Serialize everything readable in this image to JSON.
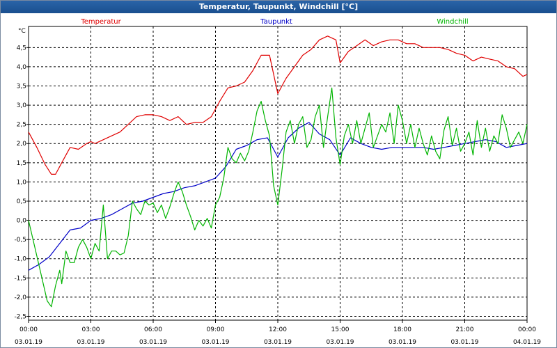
{
  "window": {
    "title": "Temperatur, Taupunkt, Windchill [°C]"
  },
  "chart_data": {
    "type": "line",
    "title": "Temperatur, Taupunkt, Windchill [°C]",
    "ylabel": "°C",
    "ylim": [
      -2.6,
      5.05
    ],
    "xlim": [
      0,
      24
    ],
    "grid": true,
    "legend_placement": "top",
    "y_ticks": [
      {
        "v": 4.5,
        "label": "4,5"
      },
      {
        "v": 4.0,
        "label": "4,0"
      },
      {
        "v": 3.5,
        "label": "3,5"
      },
      {
        "v": 3.0,
        "label": "3,0"
      },
      {
        "v": 2.5,
        "label": "2,5"
      },
      {
        "v": 2.0,
        "label": "2,0"
      },
      {
        "v": 1.5,
        "label": "1,5"
      },
      {
        "v": 1.0,
        "label": "1,0"
      },
      {
        "v": 0.5,
        "label": "0,5"
      },
      {
        "v": 0.0,
        "label": "0,0"
      },
      {
        "v": -0.5,
        "label": "-0,5"
      },
      {
        "v": -1.0,
        "label": "-1,0"
      },
      {
        "v": -1.5,
        "label": "-1,5"
      },
      {
        "v": -2.0,
        "label": "-2,0"
      },
      {
        "v": -2.5,
        "label": "-2,5"
      }
    ],
    "x_ticks": [
      {
        "v": 0,
        "time": "00:00",
        "date": "03.01.19"
      },
      {
        "v": 3,
        "time": "03:00",
        "date": "03.01.19"
      },
      {
        "v": 6,
        "time": "06:00",
        "date": "03.01.19"
      },
      {
        "v": 9,
        "time": "09:00",
        "date": "03.01.19"
      },
      {
        "v": 12,
        "time": "12:00",
        "date": "03.01.19"
      },
      {
        "v": 15,
        "time": "15:00",
        "date": "03.01.19"
      },
      {
        "v": 18,
        "time": "18:00",
        "date": "03.01.19"
      },
      {
        "v": 21,
        "time": "21:00",
        "date": "03.01.19"
      },
      {
        "v": 24,
        "time": "00:00",
        "date": "04.01.19"
      }
    ],
    "series": [
      {
        "name": "Temperatur",
        "color": "#e00000",
        "x": [
          0,
          0.4,
          0.8,
          1.1,
          1.3,
          1.6,
          2.0,
          2.4,
          2.8,
          3.0,
          3.2,
          3.6,
          4.0,
          4.4,
          4.8,
          5.2,
          5.6,
          6.0,
          6.4,
          6.8,
          7.2,
          7.6,
          8.0,
          8.4,
          8.8,
          9.2,
          9.6,
          10.0,
          10.4,
          10.8,
          11.2,
          11.6,
          12.0,
          12.4,
          12.8,
          13.2,
          13.6,
          14.0,
          14.4,
          14.8,
          15.0,
          15.4,
          15.8,
          16.2,
          16.6,
          17.0,
          17.4,
          17.8,
          18.2,
          18.6,
          19.0,
          19.4,
          19.8,
          20.2,
          20.6,
          21.0,
          21.4,
          21.8,
          22.2,
          22.6,
          23.0,
          23.4,
          23.8,
          24.0
        ],
        "values": [
          2.3,
          1.9,
          1.45,
          1.2,
          1.2,
          1.5,
          1.9,
          1.85,
          2.0,
          2.05,
          2.0,
          2.1,
          2.2,
          2.3,
          2.5,
          2.7,
          2.75,
          2.75,
          2.7,
          2.6,
          2.7,
          2.5,
          2.55,
          2.55,
          2.7,
          3.1,
          3.45,
          3.5,
          3.6,
          3.9,
          4.3,
          4.3,
          3.3,
          3.7,
          4.0,
          4.3,
          4.45,
          4.7,
          4.8,
          4.7,
          4.1,
          4.4,
          4.55,
          4.7,
          4.55,
          4.65,
          4.7,
          4.7,
          4.6,
          4.6,
          4.5,
          4.5,
          4.5,
          4.45,
          4.35,
          4.3,
          4.15,
          4.25,
          4.2,
          4.15,
          4.0,
          3.95,
          3.75,
          3.8
        ]
      },
      {
        "name": "Taupunkt",
        "color": "#0000c8",
        "x": [
          0,
          0.5,
          1.0,
          1.5,
          2.0,
          2.5,
          3.0,
          3.5,
          4.0,
          4.5,
          5.0,
          5.5,
          6.0,
          6.5,
          7.0,
          7.5,
          8.0,
          8.5,
          9.0,
          9.5,
          10.0,
          10.5,
          11.0,
          11.5,
          12.0,
          12.5,
          13.0,
          13.5,
          14.0,
          14.5,
          15.0,
          15.5,
          16.0,
          16.5,
          17.0,
          17.5,
          18.0,
          18.5,
          19.0,
          19.5,
          20.0,
          20.5,
          21.0,
          21.5,
          22.0,
          22.5,
          23.0,
          23.5,
          24.0
        ],
        "values": [
          -1.3,
          -1.15,
          -0.95,
          -0.6,
          -0.25,
          -0.2,
          0.0,
          0.05,
          0.15,
          0.3,
          0.45,
          0.5,
          0.6,
          0.7,
          0.75,
          0.85,
          0.9,
          1.0,
          1.1,
          1.4,
          1.85,
          1.95,
          2.1,
          2.15,
          1.65,
          2.15,
          2.4,
          2.55,
          2.25,
          2.1,
          1.7,
          2.15,
          2.0,
          1.9,
          1.85,
          1.9,
          1.9,
          1.9,
          1.9,
          1.85,
          1.9,
          1.95,
          2.0,
          2.05,
          2.1,
          2.05,
          1.9,
          1.95,
          2.0
        ]
      },
      {
        "name": "Windchill",
        "color": "#00b400",
        "x": [
          0,
          0.3,
          0.6,
          0.9,
          1.1,
          1.3,
          1.5,
          1.6,
          1.8,
          2.0,
          2.2,
          2.4,
          2.6,
          2.8,
          3.0,
          3.2,
          3.4,
          3.6,
          3.8,
          4.0,
          4.2,
          4.4,
          4.6,
          4.8,
          5.0,
          5.2,
          5.4,
          5.6,
          5.8,
          6.0,
          6.2,
          6.4,
          6.6,
          6.8,
          7.0,
          7.2,
          7.4,
          7.6,
          7.8,
          8.0,
          8.2,
          8.4,
          8.6,
          8.8,
          9.0,
          9.2,
          9.4,
          9.6,
          9.8,
          10.0,
          10.2,
          10.4,
          10.6,
          10.8,
          11.0,
          11.2,
          11.4,
          11.6,
          11.8,
          12.0,
          12.2,
          12.4,
          12.6,
          12.8,
          13.0,
          13.2,
          13.4,
          13.6,
          13.8,
          14.0,
          14.2,
          14.4,
          14.6,
          14.8,
          15.0,
          15.2,
          15.4,
          15.6,
          15.8,
          16.0,
          16.2,
          16.4,
          16.6,
          16.8,
          17.0,
          17.2,
          17.4,
          17.6,
          17.8,
          18.0,
          18.2,
          18.4,
          18.6,
          18.8,
          19.0,
          19.2,
          19.4,
          19.6,
          19.8,
          20.0,
          20.2,
          20.4,
          20.6,
          20.8,
          21.0,
          21.2,
          21.4,
          21.6,
          21.8,
          22.0,
          22.2,
          22.4,
          22.6,
          22.8,
          23.0,
          23.2,
          23.4,
          23.6,
          23.8,
          24.0
        ],
        "values": [
          0.0,
          -0.7,
          -1.4,
          -2.1,
          -2.25,
          -1.7,
          -1.3,
          -1.65,
          -0.8,
          -1.1,
          -1.1,
          -0.7,
          -0.5,
          -0.7,
          -1.0,
          -0.6,
          -0.8,
          0.4,
          -1.0,
          -0.8,
          -0.8,
          -0.9,
          -0.85,
          -0.4,
          0.5,
          0.3,
          0.15,
          0.5,
          0.4,
          0.45,
          0.2,
          0.4,
          0.05,
          0.35,
          0.7,
          1.0,
          0.75,
          0.4,
          0.1,
          -0.25,
          0.0,
          -0.15,
          0.05,
          -0.2,
          0.4,
          0.6,
          1.1,
          1.9,
          1.6,
          1.5,
          1.75,
          1.55,
          1.8,
          2.3,
          2.85,
          3.1,
          2.6,
          2.2,
          0.9,
          0.4,
          1.3,
          2.3,
          2.6,
          2.0,
          2.5,
          2.7,
          1.9,
          2.1,
          2.7,
          3.0,
          1.9,
          2.7,
          3.45,
          2.15,
          1.45,
          2.2,
          2.5,
          2.0,
          2.6,
          2.0,
          2.4,
          2.8,
          1.9,
          2.2,
          2.5,
          2.3,
          2.8,
          2.0,
          3.0,
          2.6,
          2.0,
          2.5,
          1.9,
          2.4,
          2.0,
          1.7,
          2.2,
          1.8,
          1.6,
          2.35,
          2.7,
          1.95,
          2.4,
          1.8,
          2.0,
          2.3,
          1.7,
          2.6,
          1.9,
          2.4,
          1.8,
          2.2,
          2.0,
          2.75,
          2.4,
          1.9,
          2.1,
          2.3,
          2.0,
          2.5
        ]
      }
    ]
  }
}
